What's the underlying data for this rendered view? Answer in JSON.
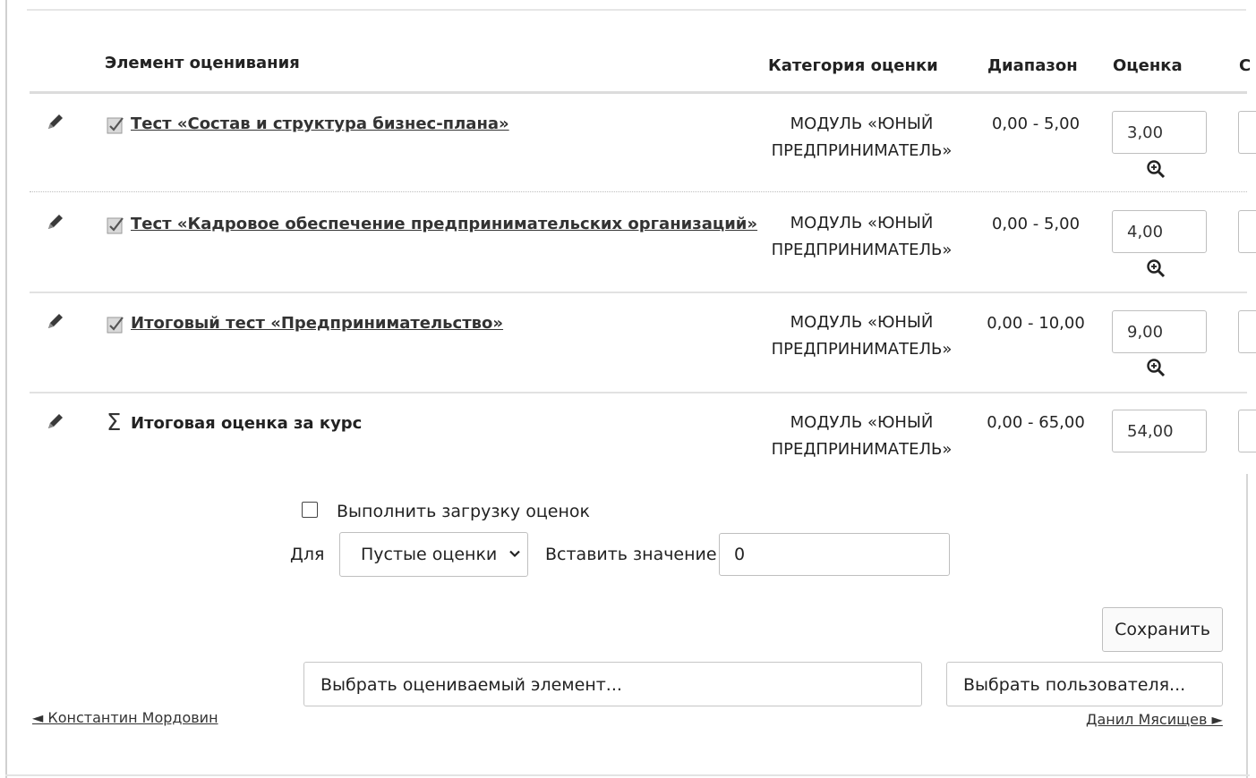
{
  "table": {
    "headers": {
      "item": "Элемент оценивания",
      "category": "Категория оценки",
      "range": "Диапазон",
      "grade": "Оценка",
      "next": "С"
    },
    "rows": [
      {
        "icon": "quiz-icon",
        "name": "Тест «Состав и структура бизнес-плана»",
        "category": [
          "МОДУЛЬ «ЮНЫЙ",
          "ПРЕДПРИНИМАТЕЛЬ»"
        ],
        "range": "0,00 - 5,00",
        "grade": "3,00"
      },
      {
        "icon": "quiz-icon",
        "name": "Тест «Кадровое обеспечение предпринимательских организаций»",
        "category": [
          "МОДУЛЬ «ЮНЫЙ",
          "ПРЕДПРИНИМАТЕЛЬ»"
        ],
        "range": "0,00 - 5,00",
        "grade": "4,00"
      },
      {
        "icon": "quiz-icon",
        "name": "Итоговый тест «Предпринимательство»",
        "category": [
          "МОДУЛЬ «ЮНЫЙ",
          "ПРЕДПРИНИМАТЕЛЬ»"
        ],
        "range": "0,00 - 10,00",
        "grade": "9,00"
      },
      {
        "icon": "sigma-icon",
        "name": "Итоговая оценка за курс",
        "category": [
          "МОДУЛЬ «ЮНЫЙ",
          "ПРЕДПРИНИМАТЕЛЬ»"
        ],
        "range": "0,00 - 65,00",
        "grade": "54,00"
      }
    ]
  },
  "bulk": {
    "checkbox_label": "Выполнить загрузку оценок",
    "checked": false,
    "for_label": "Для",
    "select_value": "Пустые оценки",
    "insert_label": "Вставить значение",
    "insert_value": "0"
  },
  "save_label": "Сохранить",
  "pickers": {
    "item": "Выбрать оцениваемый элемент...",
    "user": "Выбрать пользователя..."
  },
  "nav": {
    "prev": "◄ Константин Мордовин",
    "next": "Данил Мясищев ►"
  }
}
